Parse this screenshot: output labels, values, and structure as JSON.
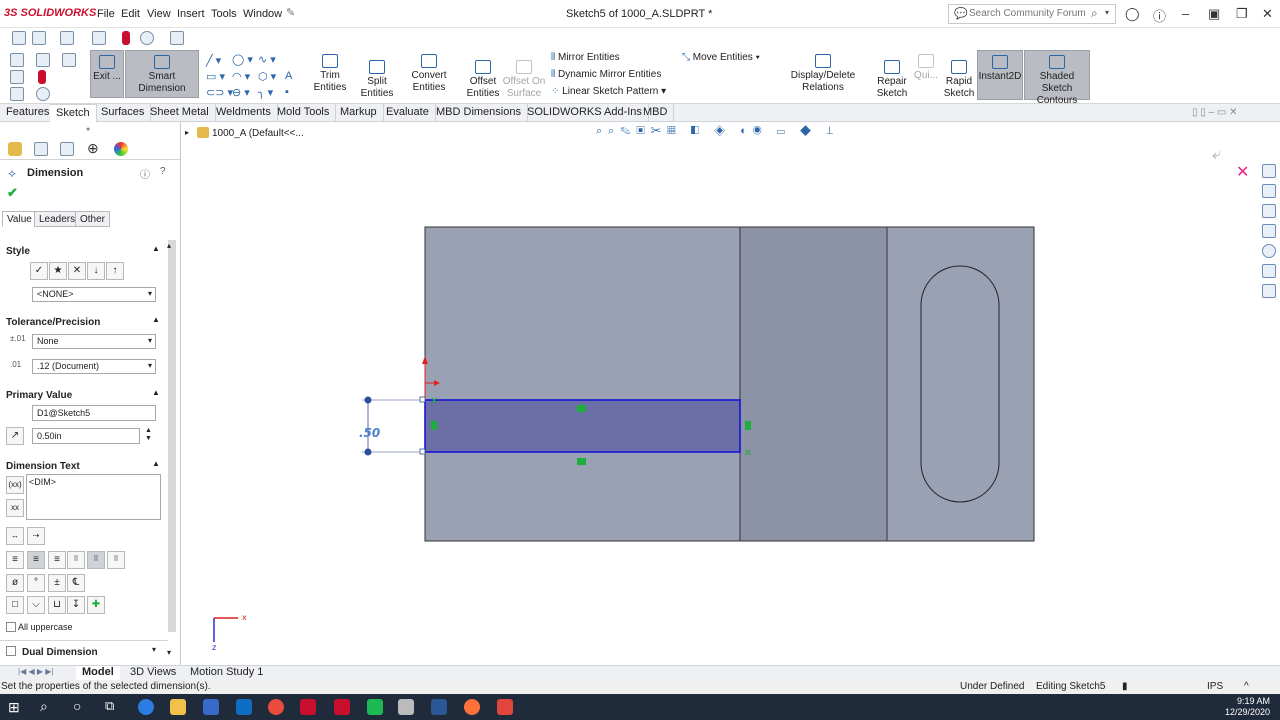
{
  "app": {
    "logo_brand": "3S",
    "logo_text": "SOLIDWORKS"
  },
  "menu": {
    "items": [
      "File",
      "Edit",
      "View",
      "Insert",
      "Tools",
      "Window"
    ]
  },
  "document_title": "Sketch5 of 1000_A.SLDPRT *",
  "search": {
    "placeholder": "Search Community Forum"
  },
  "command_manager": {
    "exit_label": "Exit ...",
    "smart_dimension_label": "Smart Dimension",
    "trim_label": "Trim Entities",
    "convert_label": "Convert Entities",
    "split_label_1": "Split",
    "split_label_2": "Entities",
    "offset_label_1": "Offset",
    "offset_label_2": "Entities",
    "offset_surface_1": "Offset On",
    "offset_surface_2": "Surface",
    "mirror_label": "Mirror Entities",
    "dynamic_mirror_label": "Dynamic Mirror Entities",
    "linear_pattern_label": "Linear Sketch Pattern",
    "move_label": "Move Entities",
    "display_delete_label": "Display/Delete Relations",
    "repair_label_1": "Repair",
    "repair_label_2": "Sketch",
    "quick_label": "Qui...",
    "rapid_label_1": "Rapid",
    "rapid_label_2": "Sketch",
    "instant2d_label": "Instant2D",
    "shaded_label_1": "Shaded Sketch",
    "shaded_label_2": "Contours"
  },
  "tabs": [
    "Features",
    "Sketch",
    "Surfaces",
    "Sheet Metal",
    "Weldments",
    "Mold Tools",
    "Markup",
    "Evaluate",
    "MBD Dimensions",
    "SOLIDWORKS Add-Ins",
    "MBD"
  ],
  "tree_path": "1000_A  (Default<<...",
  "property_manager": {
    "title": "Dimension",
    "subtabs": [
      "Value",
      "Leaders",
      "Other"
    ],
    "style_header": "Style",
    "style_value": "<NONE>",
    "tolerance_header": "Tolerance/Precision",
    "tolerance_value": "None",
    "precision_value": ".12 (Document)",
    "primary_header": "Primary Value",
    "primary_name": "D1@Sketch5",
    "primary_value": "0.50in",
    "dimension_text_header": "Dimension Text",
    "dimension_text_value": "<DIM>",
    "all_uppercase_label": "All uppercase",
    "dual_dimension_label": "Dual Dimension"
  },
  "canvas": {
    "dimension_label": ".50",
    "axis_x": "x",
    "axis_y": "z"
  },
  "bottom_tabs": [
    "Model",
    "3D Views",
    "Motion Study 1"
  ],
  "status": {
    "message": "Set the properties of the selected dimension(s).",
    "state": "Under Defined",
    "editing": "Editing Sketch5",
    "units": "IPS"
  },
  "clock": {
    "time": "9:19 AM",
    "date": "12/29/2020"
  },
  "colors": {
    "accent_red": "#c8102e",
    "part_face": "#9ba1b5",
    "part_face_dark": "#8d93a6",
    "sketch_fill": "#6b6fa6",
    "sketch_line": "#1515d6",
    "relation_green": "#1fae3b",
    "taskbar": "#1f2a3a"
  }
}
